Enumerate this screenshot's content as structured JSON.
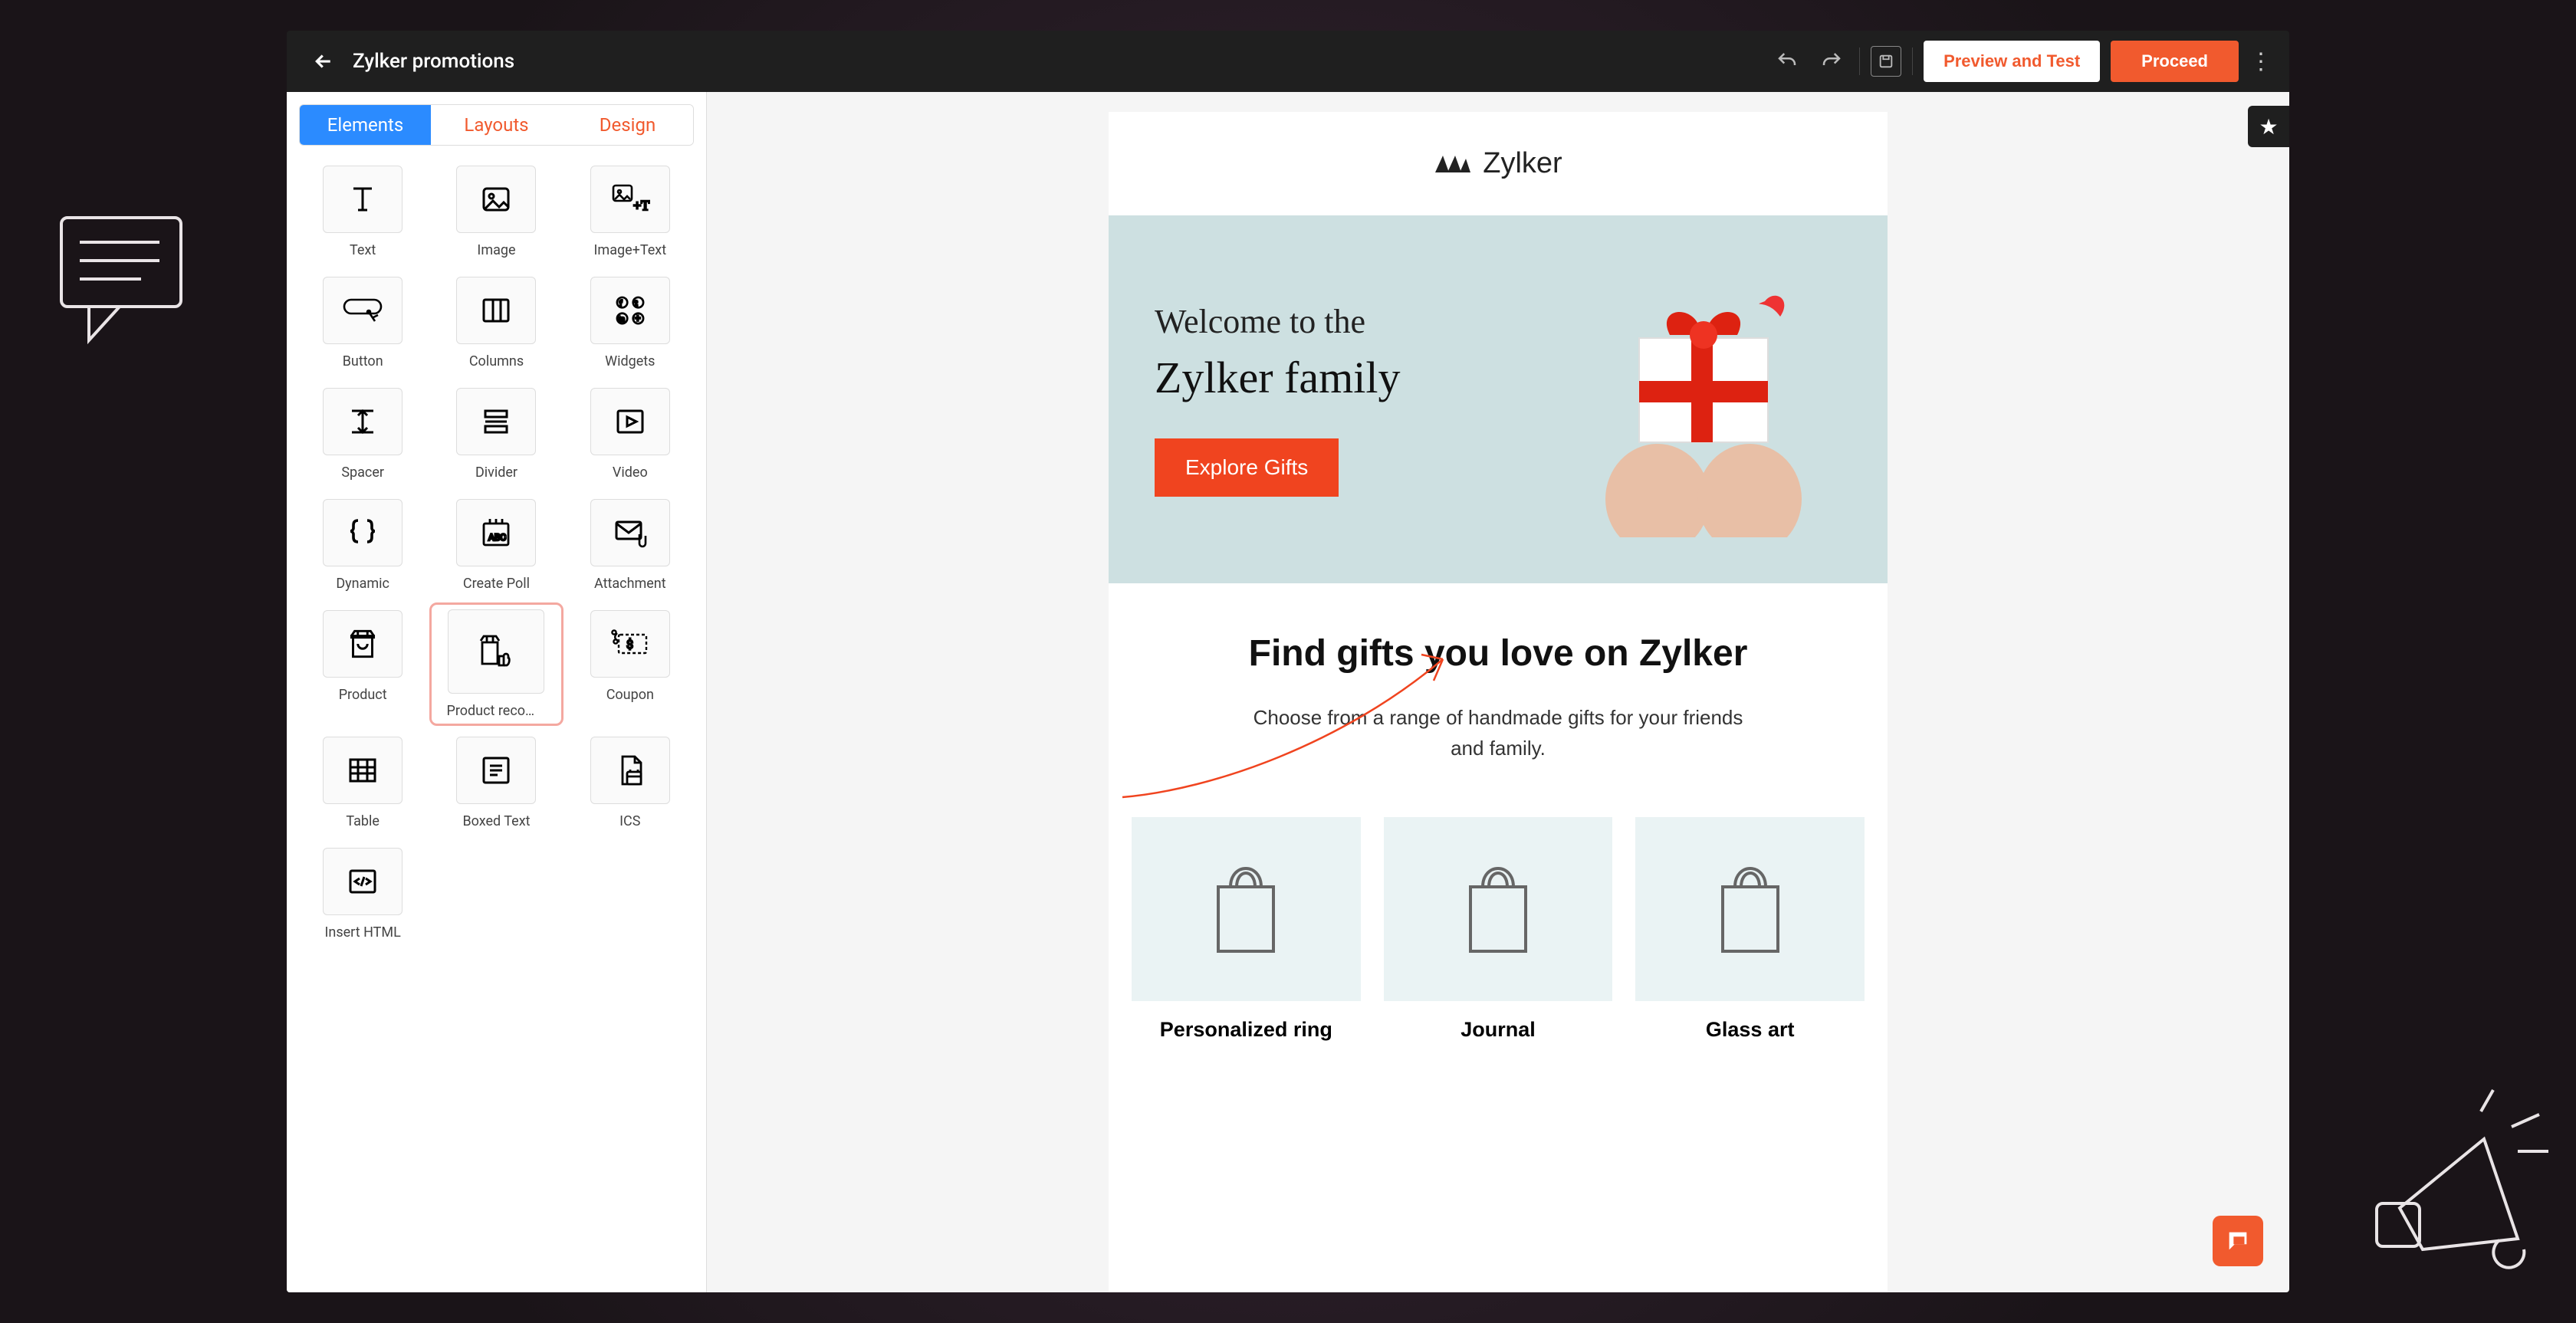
{
  "header": {
    "title": "Zylker promotions",
    "preview_label": "Preview and Test",
    "proceed_label": "Proceed"
  },
  "tabs": [
    {
      "label": "Elements",
      "active": true
    },
    {
      "label": "Layouts",
      "active": false
    },
    {
      "label": "Design",
      "active": false
    }
  ],
  "elements": [
    {
      "id": "text",
      "label": "Text",
      "icon": "text-icon"
    },
    {
      "id": "image",
      "label": "Image",
      "icon": "image-icon"
    },
    {
      "id": "imagetext",
      "label": "Image+Text",
      "icon": "image-text-icon"
    },
    {
      "id": "button",
      "label": "Button",
      "icon": "button-icon"
    },
    {
      "id": "columns",
      "label": "Columns",
      "icon": "columns-icon"
    },
    {
      "id": "widgets",
      "label": "Widgets",
      "icon": "widgets-icon"
    },
    {
      "id": "spacer",
      "label": "Spacer",
      "icon": "spacer-icon"
    },
    {
      "id": "divider",
      "label": "Divider",
      "icon": "divider-icon"
    },
    {
      "id": "video",
      "label": "Video",
      "icon": "video-icon"
    },
    {
      "id": "dynamic",
      "label": "Dynamic",
      "icon": "braces-icon"
    },
    {
      "id": "createpoll",
      "label": "Create Poll",
      "icon": "poll-icon"
    },
    {
      "id": "attachment",
      "label": "Attachment",
      "icon": "attachment-icon"
    },
    {
      "id": "product",
      "label": "Product",
      "icon": "product-icon"
    },
    {
      "id": "productrec",
      "label": "Product recommend…",
      "icon": "product-rec-icon",
      "highlighted": true
    },
    {
      "id": "coupon",
      "label": "Coupon",
      "icon": "coupon-icon"
    },
    {
      "id": "table",
      "label": "Table",
      "icon": "table-icon"
    },
    {
      "id": "boxedtext",
      "label": "Boxed Text",
      "icon": "boxed-text-icon"
    },
    {
      "id": "ics",
      "label": "ICS",
      "icon": "ics-icon"
    },
    {
      "id": "inserthtml",
      "label": "Insert HTML",
      "icon": "html-icon"
    }
  ],
  "email": {
    "brand": "Zylker",
    "hero_line1": "Welcome to the",
    "hero_line2": "Zylker family",
    "hero_cta": "Explore Gifts",
    "body_heading": "Find gifts you love on Zylker",
    "body_paragraph": "Choose from a range of handmade gifts for your friends and family.",
    "products": [
      {
        "name": "Personalized ring"
      },
      {
        "name": "Journal"
      },
      {
        "name": "Glass art"
      }
    ]
  },
  "colors": {
    "accent": "#f15a2e",
    "primary_blue": "#2b8bff",
    "hero_bg": "#cde0e1"
  }
}
